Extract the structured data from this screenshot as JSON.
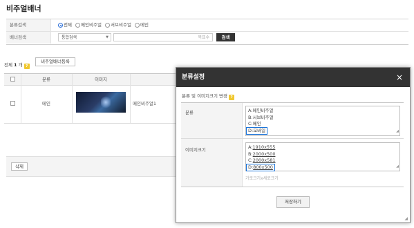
{
  "page": {
    "title": "비주얼배너"
  },
  "search": {
    "category_label": "분류검색",
    "radios": [
      {
        "label": "전체",
        "checked": true
      },
      {
        "label": "메인비주얼",
        "checked": false
      },
      {
        "label": "서브비주얼",
        "checked": false
      },
      {
        "label": "메인",
        "checked": false
      }
    ],
    "banner_label": "배너검색",
    "select_value": "통합검색",
    "input_placeholder": "목표수",
    "search_button": "검색"
  },
  "list": {
    "total_prefix": "전체",
    "total_count": "1",
    "total_suffix": "개",
    "help": "?",
    "register_button": "비주얼배너등록",
    "columns": {
      "category": "분류",
      "image": "이미지"
    },
    "rows": [
      {
        "category": "메인",
        "name": "메인비주얼1"
      }
    ],
    "delete_button": "삭제"
  },
  "modal": {
    "title": "분류설정",
    "close": "×",
    "subtitle": "분류 및 이미지크기 변경",
    "help": "?",
    "category_label": "분류",
    "category_lines": [
      {
        "prefix": "A:",
        "value": "메인비주얼"
      },
      {
        "prefix": "B:",
        "value": "서브비주얼"
      },
      {
        "prefix": "C:",
        "value": "메인"
      },
      {
        "prefix": "D:",
        "value": "모바일"
      }
    ],
    "size_label": "이미지크기",
    "size_lines": [
      {
        "prefix": "A:",
        "value": "1910x555"
      },
      {
        "prefix": "B:",
        "value": "2000x500"
      },
      {
        "prefix": "C:",
        "value": "2000x581"
      },
      {
        "prefix": "D:",
        "value": "800x500"
      }
    ],
    "size_hint": "가로크기x세로크기",
    "save_button": "저장하기"
  }
}
